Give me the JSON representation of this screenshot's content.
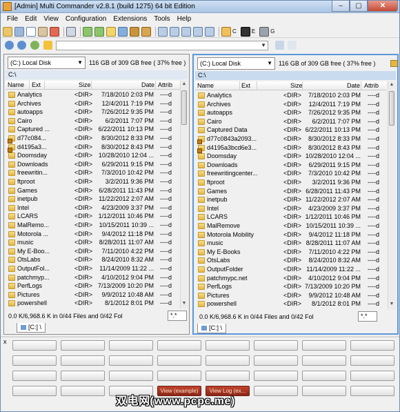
{
  "window": {
    "title": "[Admin] Multi Commander v2.8.1 (build 1275) 64 bit Edition"
  },
  "window_buttons": {
    "minimize": "‒",
    "maximize": "▢",
    "close": "✕"
  },
  "menu": [
    "File",
    "Edit",
    "View",
    "Configuration",
    "Extensions",
    "Tools",
    "Help"
  ],
  "toolbar": {
    "drive_labels": [
      "C",
      "E",
      "G"
    ]
  },
  "left_panel": {
    "drive": "(C:) Local Disk",
    "free": "116 GB of 309 GB free ( 37% free )",
    "path": "C:\\",
    "columns": [
      "Name",
      "Ext",
      "Size",
      "Date",
      "Attrib"
    ],
    "rows": [
      {
        "name": "Analytics",
        "size": "<DIR>",
        "date": "7/18/2010 2:03 PM",
        "attr": "----d",
        "lock": false
      },
      {
        "name": "Archives",
        "size": "<DIR>",
        "date": "12/4/2011 7:19 PM",
        "attr": "----d",
        "lock": false
      },
      {
        "name": "autoapps",
        "size": "<DIR>",
        "date": "7/26/2012 9:35 PM",
        "attr": "----d",
        "lock": false
      },
      {
        "name": "Cairo",
        "size": "<DIR>",
        "date": "6/2/2011 7:07 PM",
        "attr": "----d",
        "lock": false
      },
      {
        "name": "Captured ...",
        "size": "<DIR>",
        "date": "6/22/2011 10:13 PM",
        "attr": "----d",
        "lock": false
      },
      {
        "name": "d77c084...",
        "size": "<DIR>",
        "date": "8/30/2012 8:33 PM",
        "attr": "----d",
        "lock": true
      },
      {
        "name": "d4195a3...",
        "size": "<DIR>",
        "date": "8/30/2012 8:43 PM",
        "attr": "----d",
        "lock": true
      },
      {
        "name": "Doomsday",
        "size": "<DIR>",
        "date": "10/28/2010 12:04 ...",
        "attr": "----d",
        "lock": false
      },
      {
        "name": "Downloads",
        "size": "<DIR>",
        "date": "6/29/2011 9:15 PM",
        "attr": "----d",
        "lock": false
      },
      {
        "name": "freewritin...",
        "size": "<DIR>",
        "date": "7/3/2010 10:42 PM",
        "attr": "----d",
        "lock": false
      },
      {
        "name": "ftproot",
        "size": "<DIR>",
        "date": "3/2/2011 9:36 PM",
        "attr": "----d",
        "lock": false
      },
      {
        "name": "Games",
        "size": "<DIR>",
        "date": "6/28/2011 11:43 PM",
        "attr": "----d",
        "lock": false
      },
      {
        "name": "inetpub",
        "size": "<DIR>",
        "date": "11/22/2012 2:07 AM",
        "attr": "----d",
        "lock": false
      },
      {
        "name": "Intel",
        "size": "<DIR>",
        "date": "4/23/2009 3:37 PM",
        "attr": "----d",
        "lock": false
      },
      {
        "name": "LCARS",
        "size": "<DIR>",
        "date": "1/12/2011 10:46 PM",
        "attr": "----d",
        "lock": false
      },
      {
        "name": "MalRemo...",
        "size": "<DIR>",
        "date": "10/15/2011 10:39 ...",
        "attr": "----d",
        "lock": false
      },
      {
        "name": "Motorola ...",
        "size": "<DIR>",
        "date": "9/4/2012 11:18 PM",
        "attr": "----d",
        "lock": false
      },
      {
        "name": "music",
        "size": "<DIR>",
        "date": "8/28/2011 11:07 AM",
        "attr": "----d",
        "lock": false
      },
      {
        "name": "My E-Boo...",
        "size": "<DIR>",
        "date": "7/11/2010 4:22 PM",
        "attr": "----d",
        "lock": false
      },
      {
        "name": "OtsLabs",
        "size": "<DIR>",
        "date": "8/24/2010 8:32 AM",
        "attr": "----d",
        "lock": false
      },
      {
        "name": "OutputFol...",
        "size": "<DIR>",
        "date": "11/14/2009 11:22 ...",
        "attr": "----d",
        "lock": false
      },
      {
        "name": "patchmyp...",
        "size": "<DIR>",
        "date": "4/10/2012 9:04 PM",
        "attr": "----d",
        "lock": false
      },
      {
        "name": "PerfLogs",
        "size": "<DIR>",
        "date": "7/13/2009 10:20 PM",
        "attr": "----d",
        "lock": false
      },
      {
        "name": "Pictures",
        "size": "<DIR>",
        "date": "9/9/2012 10:48 AM",
        "attr": "----d",
        "lock": false
      },
      {
        "name": "powershell",
        "size": "<DIR>",
        "date": "8/1/2012 8:01 PM",
        "attr": "----d",
        "lock": false
      }
    ],
    "status": "0.0 K/6,968.6 K in 0/44 Files and 0/42 Fol",
    "filter": "*.*",
    "tab": "[C:] \\"
  },
  "right_panel": {
    "drive": "(C:) Local Disk",
    "free": "116 GB of 309 GB free ( 37% free )",
    "path": "C:\\",
    "columns": [
      "Name",
      "Ext",
      "Size",
      "Date",
      "Attrib"
    ],
    "rows": [
      {
        "name": "Analytics",
        "size": "<DIR>",
        "date": "7/18/2010 2:03 PM",
        "attr": "----d",
        "lock": false
      },
      {
        "name": "Archives",
        "size": "<DIR>",
        "date": "12/4/2011 7:19 PM",
        "attr": "----d",
        "lock": false
      },
      {
        "name": "autoapps",
        "size": "<DIR>",
        "date": "7/26/2012 9:35 PM",
        "attr": "----d",
        "lock": false
      },
      {
        "name": "Cairo",
        "size": "<DIR>",
        "date": "6/2/2011 7:07 PM",
        "attr": "----d",
        "lock": false
      },
      {
        "name": "Captured Data",
        "size": "<DIR>",
        "date": "6/22/2011 10:13 PM",
        "attr": "----d",
        "lock": false
      },
      {
        "name": "d77c0843a2093...",
        "size": "<DIR>",
        "date": "8/30/2012 8:33 PM",
        "attr": "----d",
        "lock": true
      },
      {
        "name": "d4195a3bcd6e3...",
        "size": "<DIR>",
        "date": "8/30/2012 8:43 PM",
        "attr": "----d",
        "lock": true
      },
      {
        "name": "Doomsday",
        "size": "<DIR>",
        "date": "10/28/2010 12:04 ...",
        "attr": "----d",
        "lock": false
      },
      {
        "name": "Downloads",
        "size": "<DIR>",
        "date": "6/29/2011 9:15 PM",
        "attr": "----d",
        "lock": false
      },
      {
        "name": "freewritingcenter...",
        "size": "<DIR>",
        "date": "7/3/2010 10:42 PM",
        "attr": "----d",
        "lock": false
      },
      {
        "name": "ftproot",
        "size": "<DIR>",
        "date": "3/2/2011 9:36 PM",
        "attr": "----d",
        "lock": false
      },
      {
        "name": "Games",
        "size": "<DIR>",
        "date": "6/28/2011 11:43 PM",
        "attr": "----d",
        "lock": false
      },
      {
        "name": "inetpub",
        "size": "<DIR>",
        "date": "11/22/2012 2:07 AM",
        "attr": "----d",
        "lock": false
      },
      {
        "name": "Intel",
        "size": "<DIR>",
        "date": "4/23/2009 3:37 PM",
        "attr": "----d",
        "lock": false
      },
      {
        "name": "LCARS",
        "size": "<DIR>",
        "date": "1/12/2011 10:46 PM",
        "attr": "----d",
        "lock": false
      },
      {
        "name": "MalRemove",
        "size": "<DIR>",
        "date": "10/15/2011 10:39 ...",
        "attr": "----d",
        "lock": false
      },
      {
        "name": "Motorola Mobility",
        "size": "<DIR>",
        "date": "9/4/2012 11:18 PM",
        "attr": "----d",
        "lock": false
      },
      {
        "name": "music",
        "size": "<DIR>",
        "date": "8/28/2011 11:07 AM",
        "attr": "----d",
        "lock": false
      },
      {
        "name": "My E-Books",
        "size": "<DIR>",
        "date": "7/11/2010 4:22 PM",
        "attr": "----d",
        "lock": false
      },
      {
        "name": "OtsLabs",
        "size": "<DIR>",
        "date": "8/24/2010 8:32 AM",
        "attr": "----d",
        "lock": false
      },
      {
        "name": "OutputFolder",
        "size": "<DIR>",
        "date": "11/14/2009 11:22 ...",
        "attr": "----d",
        "lock": false
      },
      {
        "name": "patchmypc.net",
        "size": "<DIR>",
        "date": "4/10/2012 9:04 PM",
        "attr": "----d",
        "lock": false
      },
      {
        "name": "PerfLogs",
        "size": "<DIR>",
        "date": "7/13/2009 10:20 PM",
        "attr": "----d",
        "lock": false
      },
      {
        "name": "Pictures",
        "size": "<DIR>",
        "date": "9/9/2012 10:48 AM",
        "attr": "----d",
        "lock": false
      },
      {
        "name": "powershell",
        "size": "<DIR>",
        "date": "8/1/2012 8:01 PM",
        "attr": "----d",
        "lock": false
      }
    ],
    "status": "0.0 K/6,968.6 K in 0/44 Files and 0/42 Fol",
    "filter": "*.*",
    "tab": "[C:] \\"
  },
  "button_panel": {
    "close_label": "x",
    "buttons": [
      "",
      "",
      "",
      "",
      "",
      "",
      "",
      "",
      "",
      "",
      "",
      "",
      "",
      "",
      "",
      "",
      "",
      "",
      "",
      "",
      "",
      "",
      "",
      "",
      "",
      "",
      "",
      "View (example)",
      "View Log (ex...",
      "",
      "",
      ""
    ],
    "red_buttons": [
      27,
      28
    ]
  },
  "watermark": "双电网(www.pcpc.me)",
  "colors": {
    "active_panel_border": "#5a98d9",
    "folder": "#e3b647",
    "red_button": "#a8321e"
  }
}
